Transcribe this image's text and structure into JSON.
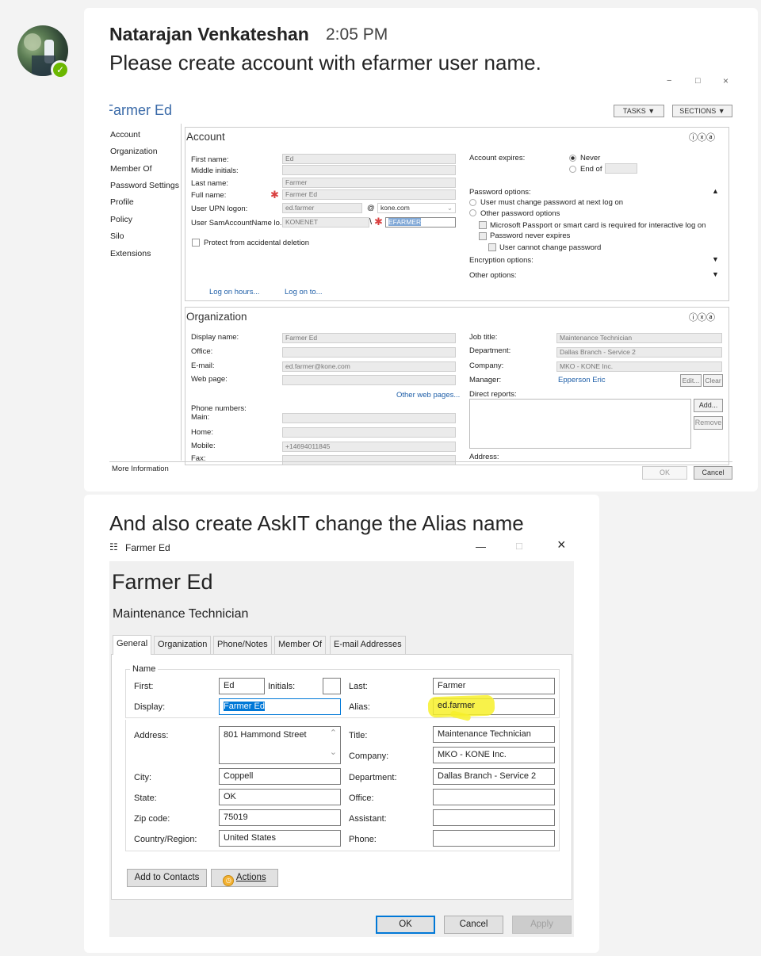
{
  "chat": {
    "sender": "Natarajan Venkateshan",
    "time": "2:05 PM",
    "message1": "Please create account with efarmer user name.",
    "message2": "And also create AskIT change the Alias name",
    "presence_icon": "check-icon",
    "presence_color": "#6bb700"
  },
  "adac": {
    "window_controls": [
      "−",
      "□",
      "×"
    ],
    "title": "Farmer Ed",
    "tasks": "TASKS",
    "sections": "SECTIONS",
    "nav": [
      "Account",
      "Organization",
      "Member Of",
      "Password Settings",
      "Profile",
      "Policy",
      "Silo",
      "Extensions"
    ],
    "account": {
      "header": "Account",
      "first_name_label": "First name:",
      "first_name": "Ed",
      "middle_initials_label": "Middle initials:",
      "last_name_label": "Last name:",
      "last_name": "Farmer",
      "full_name_label": "Full name:",
      "full_name": "Farmer Ed",
      "upn_label": "User UPN logon:",
      "upn": "ed.farmer",
      "at": "@",
      "domain": "kone.com",
      "sam_label": "User SamAccountName lo...",
      "sam_domain": "KONENET",
      "sam_sep": "\\",
      "sam": "EFARMER",
      "protect": "Protect from accidental deletion",
      "expires_label": "Account expires:",
      "never": "Never",
      "end_of": "End of",
      "password_options": "Password options:",
      "pw_opt1": "User must change password at next log on",
      "pw_opt2": "Other password options",
      "pw_opt3": "Microsoft Passport or smart card is required for interactive log on",
      "pw_opt4": "Password never expires",
      "pw_opt5": "User cannot change password",
      "encryption": "Encryption options:",
      "other": "Other options:",
      "logon_hours": "Log on hours...",
      "logon_to": "Log on to..."
    },
    "organization": {
      "header": "Organization",
      "display_label": "Display name:",
      "display": "Farmer Ed",
      "office_label": "Office:",
      "email_label": "E-mail:",
      "email": "ed.farmer@kone.com",
      "web_label": "Web page:",
      "other_web": "Other web pages...",
      "phone_numbers": "Phone numbers:",
      "main_label": "Main:",
      "home_label": "Home:",
      "mobile_label": "Mobile:",
      "mobile": "+14694011845",
      "fax_label": "Fax:",
      "job_label": "Job title:",
      "job": "Maintenance Technician",
      "dept_label": "Department:",
      "dept": "Dallas Branch - Service 2",
      "company_label": "Company:",
      "company": "MKO - KONE Inc.",
      "manager_label": "Manager:",
      "manager": "Epperson Eric",
      "edit": "Edit...",
      "clear": "Clear",
      "direct_reports": "Direct reports:",
      "add": "Add...",
      "remove": "Remove",
      "address": "Address:"
    },
    "more_info": "More Information",
    "ok": "OK",
    "cancel": "Cancel"
  },
  "outlook": {
    "window_title": "Farmer Ed",
    "window_controls": [
      "—",
      "□",
      "×"
    ],
    "name": "Farmer Ed",
    "job_title": "Maintenance Technician",
    "tabs": [
      "General",
      "Organization",
      "Phone/Notes",
      "Member Of",
      "E-mail Addresses"
    ],
    "name_group": "Name",
    "first_label": "First:",
    "first": "Ed",
    "initials_label": "Initials:",
    "initials": "",
    "last_label": "Last:",
    "last": "Farmer",
    "display_label": "Display:",
    "display": "Farmer Ed",
    "alias_label": "Alias:",
    "alias": "ed.farmer",
    "address_label": "Address:",
    "address": "801 Hammond Street",
    "title_label": "Title:",
    "title": "Maintenance Technician",
    "company_label": "Company:",
    "company": "MKO - KONE Inc.",
    "city_label": "City:",
    "city": "Coppell",
    "department_label": "Department:",
    "department": "Dallas Branch - Service 2",
    "state_label": "State:",
    "state": "OK",
    "office_label": "Office:",
    "office": "",
    "zip_label": "Zip code:",
    "zip": "75019",
    "assistant_label": "Assistant:",
    "assistant": "",
    "country_label": "Country/Region:",
    "country": "United States",
    "phone_label": "Phone:",
    "phone": "",
    "add_to_contacts": "Add to Contacts",
    "actions": "Actions",
    "ok": "OK",
    "cancel": "Cancel",
    "apply": "Apply",
    "highlight_color": "#f7f02a",
    "selection_color": "#0078d7"
  }
}
